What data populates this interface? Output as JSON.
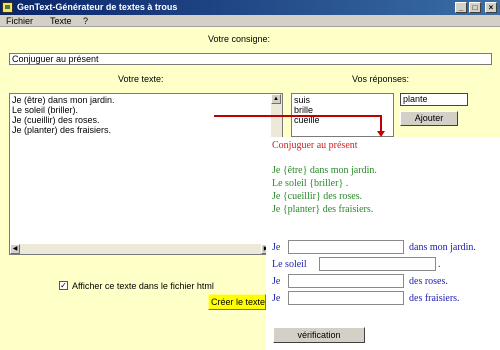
{
  "window": {
    "title": "GenText-Générateur de textes à trous",
    "minimize": "_",
    "maximize": "□",
    "close": "×"
  },
  "menu": {
    "items": [
      "Fichier",
      "Texte",
      "?"
    ]
  },
  "consigne": {
    "label": "Votre consigne:",
    "value": "Conjuguer au présent"
  },
  "texte": {
    "label": "Votre texte:",
    "lines": [
      "Je (être) dans mon jardin.",
      "Le soleil (briller).",
      "Je (cueillir) des roses.",
      "Je (planter) des fraisiers."
    ]
  },
  "reponses": {
    "label": "Vos réponses:",
    "items": [
      "suis",
      "brille",
      "cueille"
    ],
    "input_value": "plante",
    "add_button": "Ajouter"
  },
  "preview": {
    "title": "Conjuguer au présent",
    "lines": [
      "Je  {être}  dans mon jardin.",
      "Le soleil  {briller} .",
      "Je  {cueillir}  des roses.",
      "Je  {planter}  des fraisiers."
    ],
    "exercise": [
      {
        "before": "Je",
        "after": "dans mon jardin."
      },
      {
        "before": "Le soleil",
        "after": "."
      },
      {
        "before": "Je",
        "after": "des roses."
      },
      {
        "before": "Je",
        "after": "des fraisiers."
      }
    ],
    "check_button": "vérification"
  },
  "html_option": {
    "label": "Afficher ce texte dans le fichier html",
    "checked": true
  },
  "create_button": "Créer le texte"
}
